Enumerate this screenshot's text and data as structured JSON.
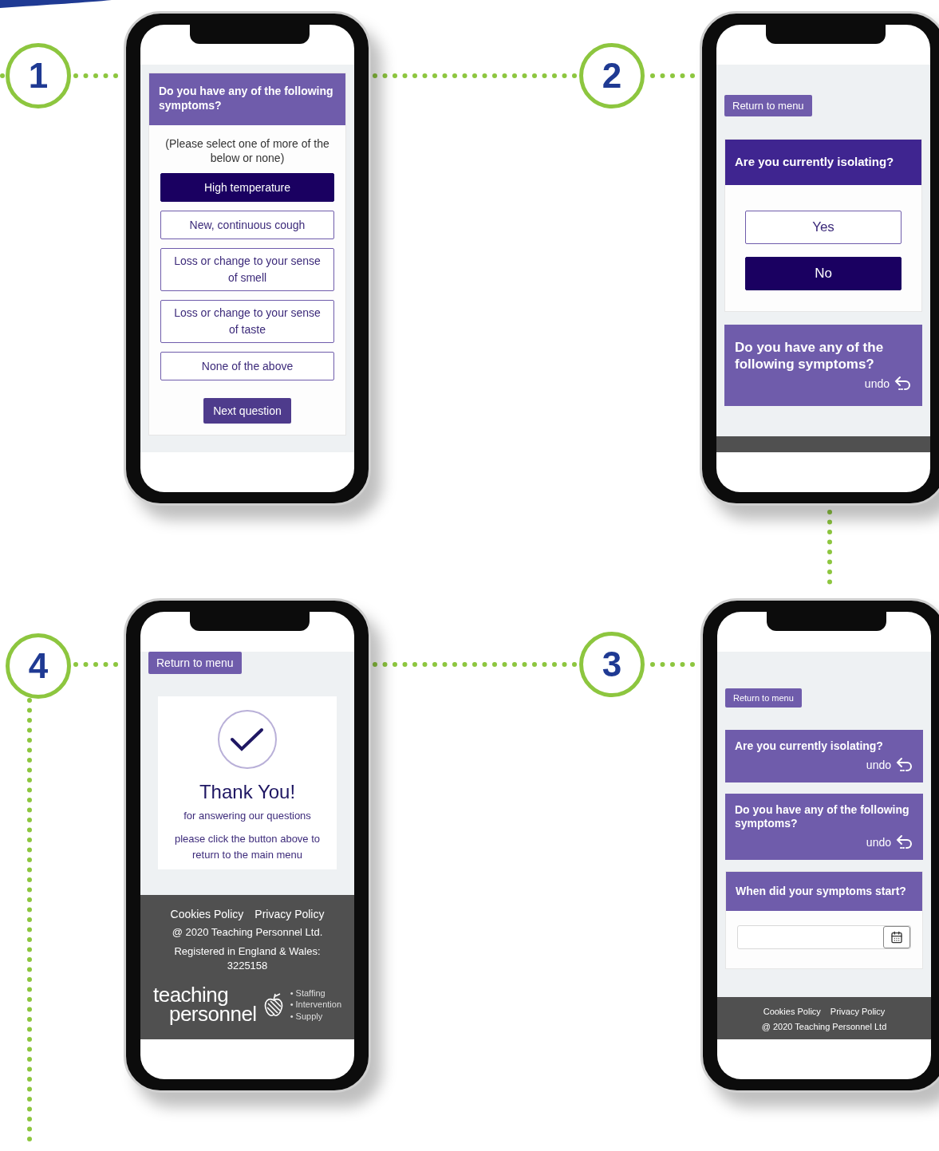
{
  "steps": [
    {
      "number": "1"
    },
    {
      "number": "2"
    },
    {
      "number": "4"
    },
    {
      "number": "3"
    }
  ],
  "screens": [
    {
      "kind": "symptoms",
      "question": "Do you have any of the following symptoms?",
      "instruction": "(Please select one of more of the below or none)",
      "options": [
        {
          "label": "High temperature",
          "selected": true
        },
        {
          "label": "New, continuous cough",
          "selected": false
        },
        {
          "label": "Loss or change to your sense of smell",
          "selected": false
        },
        {
          "label": "Loss or change to your sense of taste",
          "selected": false
        },
        {
          "label": "None of the above",
          "selected": false
        }
      ],
      "submit": "Next question"
    },
    {
      "kind": "isolating",
      "menu_button": "Return to menu",
      "question": "Are you currently isolating?",
      "options": [
        {
          "label": "Yes",
          "selected": false
        },
        {
          "label": "No",
          "selected": true
        }
      ],
      "answered": [
        {
          "question": "Do you have any of the following symptoms?",
          "undo": "undo"
        }
      ]
    },
    {
      "kind": "thanks",
      "menu_button": "Return to menu",
      "title": "Thank You!",
      "subtitle": "for answering our questions",
      "note": "please click the button above to return to the main menu",
      "footer": {
        "links": [
          "Cookies Policy",
          "Privacy Policy"
        ],
        "legal": [
          "@ 2020 Teaching Personnel Ltd.",
          "Registered in England & Wales: 3225158"
        ],
        "logo": {
          "line_1": "teaching",
          "line_2": "personnel",
          "services": [
            "• Staffing",
            "• Intervention",
            "• Supply"
          ]
        }
      }
    },
    {
      "kind": "start_date",
      "menu_button": "Return to menu",
      "answered": [
        {
          "question": "Are you currently isolating?",
          "undo": "undo"
        },
        {
          "question": "Do you have any of the following symptoms?",
          "undo": "undo"
        }
      ],
      "question": "When did your symptoms start?",
      "footer": {
        "links": [
          "Cookies Policy",
          "Privacy Policy"
        ],
        "legal": [
          "@ 2020 Teaching Personnel Ltd"
        ]
      }
    }
  ]
}
